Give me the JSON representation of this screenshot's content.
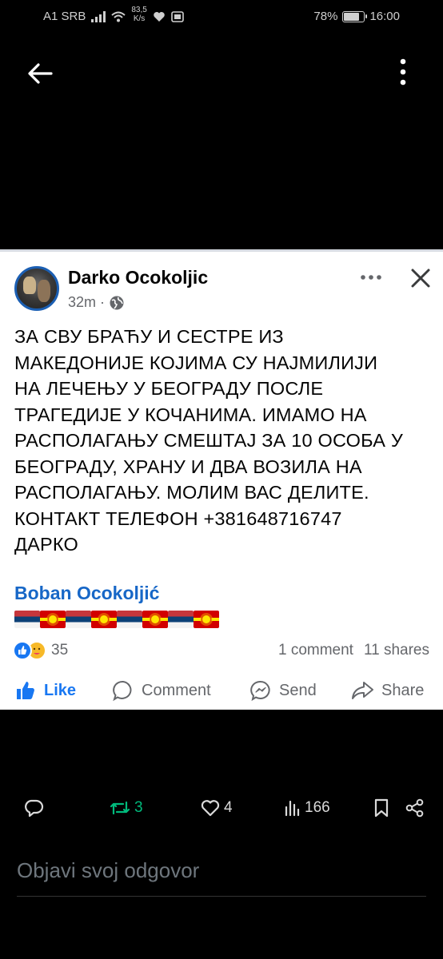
{
  "status_bar": {
    "carrier": "A1 SRB",
    "net_speed_value": "83,5",
    "net_speed_unit": "K/s",
    "battery_percent": "78%",
    "battery_level": 0.78,
    "time": "16:00"
  },
  "post": {
    "author": "Darko Ocokoljic",
    "time": "32m",
    "privacy_icon": "globe-icon",
    "text_lines": [
      "ЗА СВУ БРАЋУ И СЕСТРЕ ИЗ",
      "МАКЕДОНИЈЕ КОЈИМА СУ НАЈМИЛИЈИ",
      "НА ЛЕЧЕЊУ У БЕОГРАДУ  ПОСЛЕ",
      "ТРАГЕДИЈЕ У КОЧАНИМА. ИМАМО НА",
      "РАСПОЛАГАЊУ СМЕШТАЈ ЗА 10 ОСОБА У",
      "БЕОГРАДУ, ХРАНУ И ДВА ВОЗИЛА НА",
      "РАСПОЛАГАЊУ. МОЛИМ ВАС ДЕЛИТЕ.",
      "КОНТАКТ ТЕЛЕФОН +381648716747",
      "ДАРКО"
    ],
    "shared_by": "Boban Ocokoljić",
    "flags": [
      "rs",
      "mk",
      "rs",
      "mk",
      "rs",
      "mk",
      "rs",
      "mk"
    ],
    "reaction_count": "35",
    "comments": "1 comment",
    "shares": "11 shares",
    "actions": {
      "like": "Like",
      "comment": "Comment",
      "send": "Send",
      "share": "Share"
    }
  },
  "tweet_bar": {
    "retweets": "3",
    "likes": "4",
    "views": "166"
  },
  "reply": {
    "placeholder": "Objavi svoj odgovor"
  },
  "colors": {
    "fb_blue": "#1877f2",
    "shared_name_blue": "#1767c7",
    "retweet_green": "#00ba7c",
    "background": "#000000"
  }
}
